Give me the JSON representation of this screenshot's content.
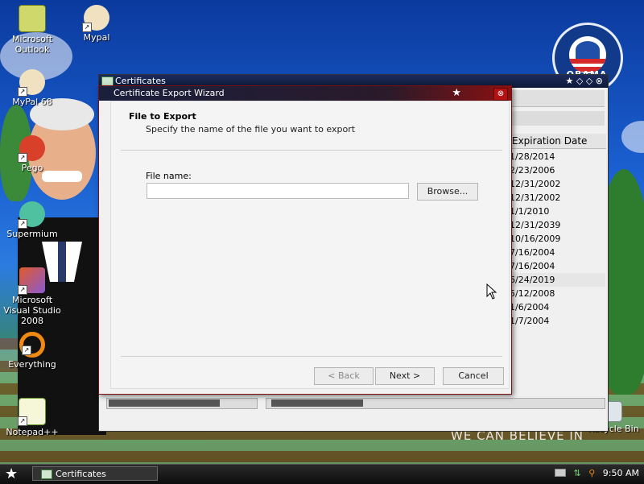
{
  "desktop": {
    "icons": [
      {
        "name": "microsoft-outlook-icon",
        "label": "Microsoft Outlook"
      },
      {
        "name": "mypal-icon",
        "label": "Mypal"
      },
      {
        "name": "mypal68-icon",
        "label": "MyPal 68"
      },
      {
        "name": "pego-icon",
        "label": "Pego"
      },
      {
        "name": "supermium-icon",
        "label": "Supermium"
      },
      {
        "name": "visual-studio-icon",
        "label": "Microsoft Visual Studio 2008"
      },
      {
        "name": "everything-icon",
        "label": "Everything"
      },
      {
        "name": "notepadpp-icon",
        "label": "Notepad++"
      }
    ],
    "recycle_bin": {
      "label": "Recycle Bin"
    },
    "logo_text": "OBAMA",
    "slogan": "WE CAN BELIEVE IN"
  },
  "cert_window": {
    "title": "Certificates",
    "column_header": "Expiration Date",
    "dates": [
      "1/28/2014",
      "2/23/2006",
      "12/31/2002",
      "12/31/2002",
      "1/1/2010",
      "12/31/2039",
      "10/16/2009",
      "7/16/2004",
      "7/16/2004",
      "6/24/2019",
      "5/12/2008",
      "1/6/2004",
      "1/7/2004"
    ],
    "selected_index": 9
  },
  "wizard": {
    "title": "Certificate Export Wizard",
    "heading": "File to Export",
    "subheading": "Specify the name of the file you want to export",
    "file_name_label": "File name:",
    "file_name_value": "",
    "browse_label": "Browse...",
    "back_label": "< Back",
    "next_label": "Next >",
    "cancel_label": "Cancel"
  },
  "taskbar": {
    "task_label": "Certificates",
    "clock": "9:50 AM"
  },
  "colors": {
    "wizard_title_accent": "#8b1010",
    "desktop_blue": "#1a5fd0"
  }
}
